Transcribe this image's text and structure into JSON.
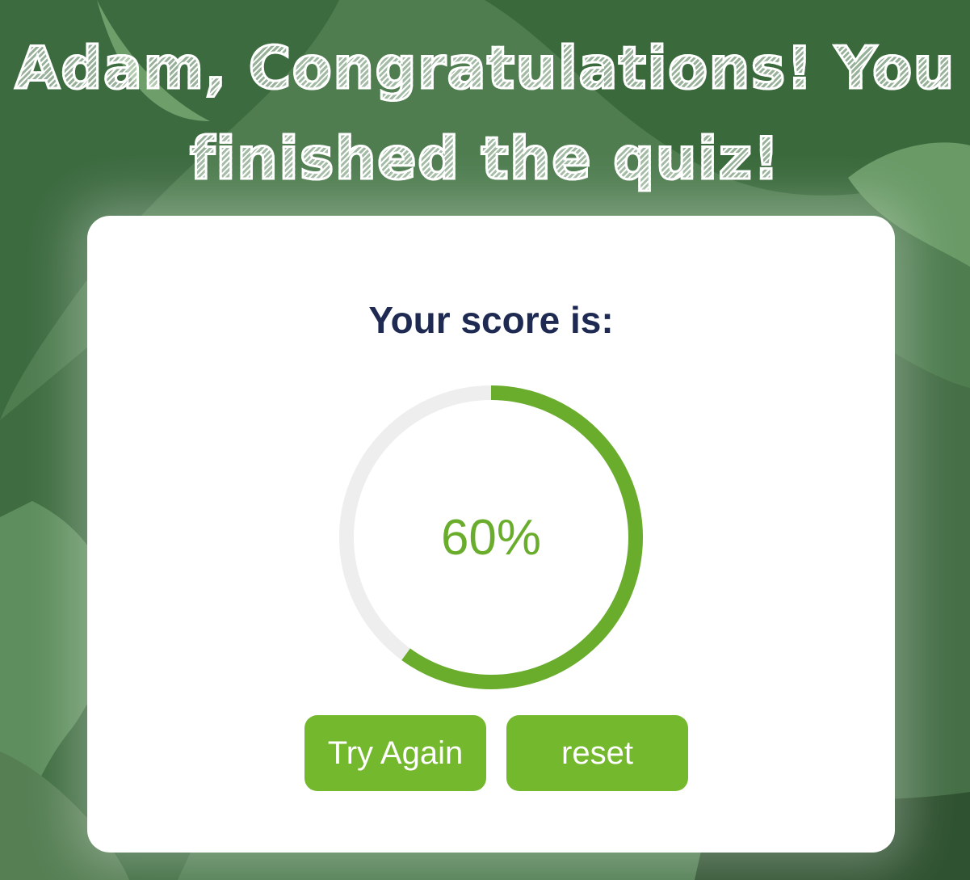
{
  "header": {
    "title": "Adam, Congratulations! You finished the quiz!"
  },
  "result": {
    "label": "Your score is:",
    "score_text": "60%",
    "score_fraction": 0.6
  },
  "actions": {
    "try_again_label": "Try Again",
    "reset_label": "reset"
  },
  "colors": {
    "accent": "#74b82d",
    "score_text": "#6aad2c",
    "track": "#eeeeee",
    "label": "#1e2a52",
    "card": "#ffffff",
    "background": "#4d7a4f"
  },
  "icons": {
    "background": "jungle-foliage-illustration"
  }
}
